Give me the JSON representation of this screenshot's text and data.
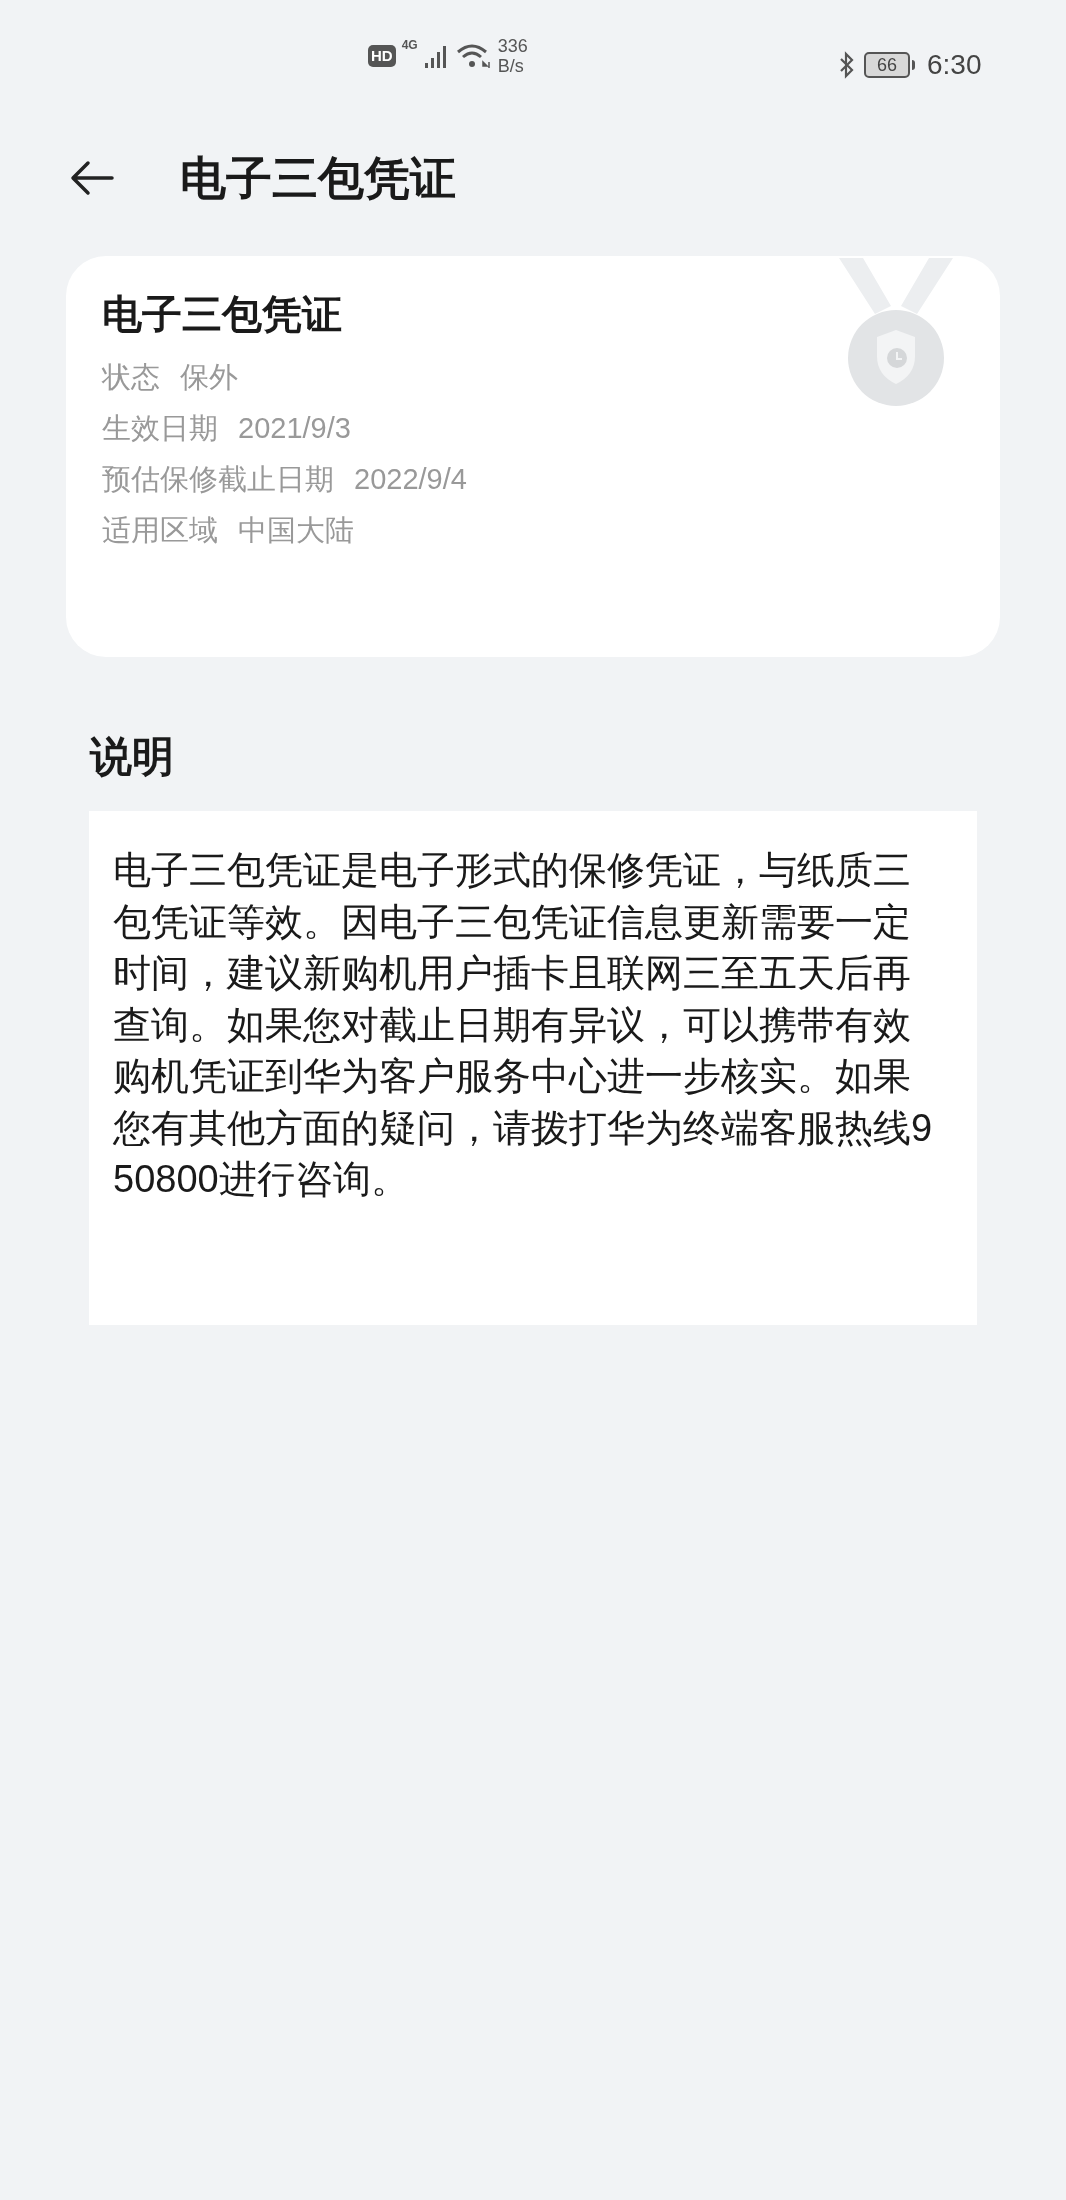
{
  "status_bar": {
    "hd": "HD",
    "network": "4G",
    "speed_value": "336",
    "speed_unit": "B/s",
    "battery": "66",
    "time": "6:30"
  },
  "header": {
    "title": "电子三包凭证"
  },
  "card": {
    "title": "电子三包凭证",
    "rows": [
      {
        "label": "状态",
        "value": "保外"
      },
      {
        "label": "生效日期",
        "value": "2021/9/3"
      },
      {
        "label": "预估保修截止日期",
        "value": "2022/9/4"
      },
      {
        "label": "适用区域",
        "value": "中国大陆"
      }
    ]
  },
  "section": {
    "title": "说明",
    "text": "电子三包凭证是电子形式的保修凭证，与纸质三包凭证等效。因电子三包凭证信息更新需要一定时间，建议新购机用户插卡且联网三至五天后再查询。如果您对截止日期有异议，可以携带有效购机凭证到华为客户服务中心进一步核实。如果您有其他方面的疑问，请拨打华为终端客服热线950800进行咨询。"
  }
}
